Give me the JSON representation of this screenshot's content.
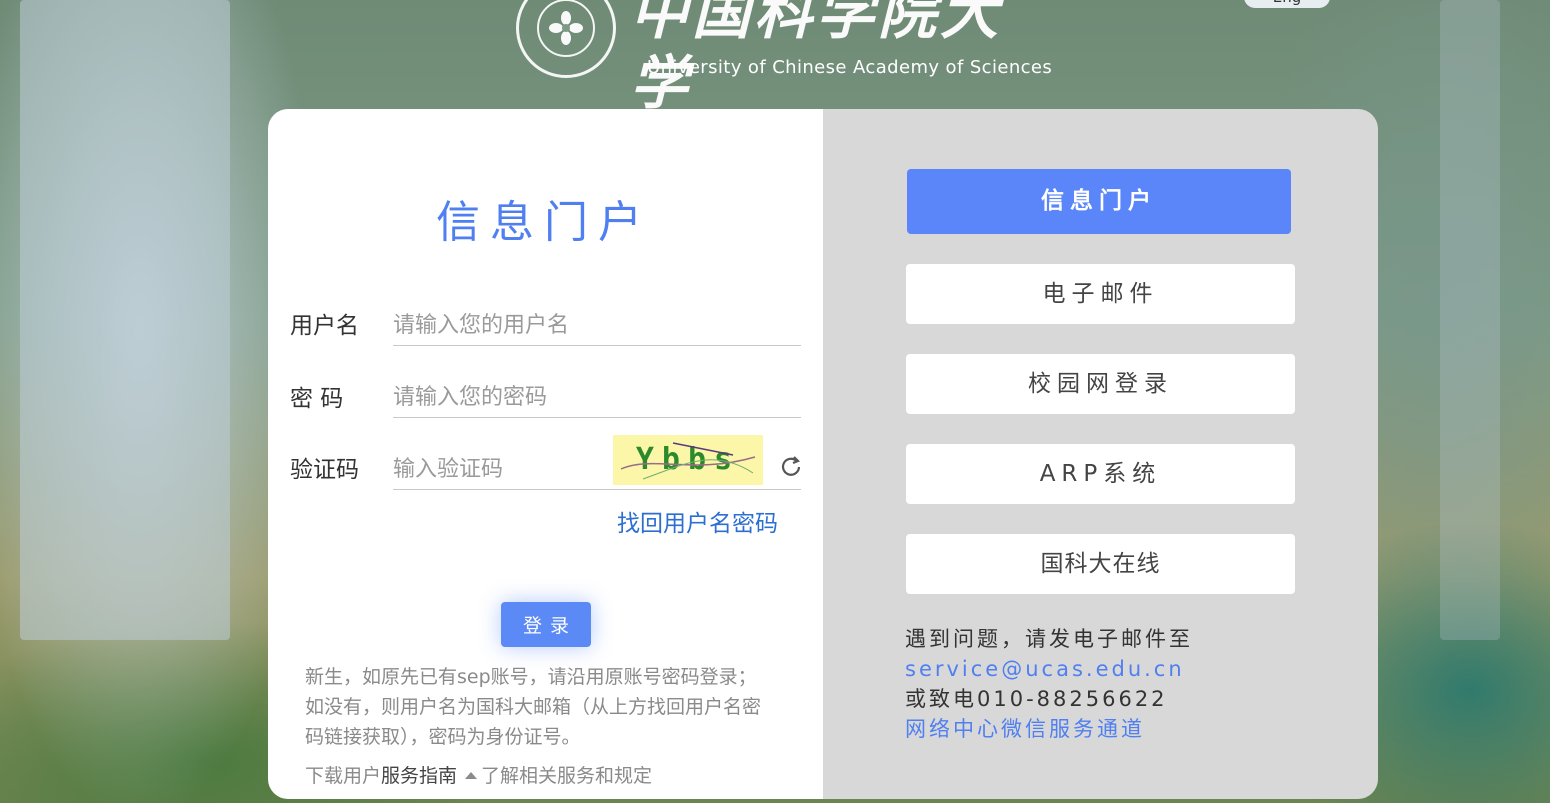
{
  "header": {
    "logo_cn": "中国科学院大学",
    "logo_en": "University of Chinese Academy of Sciences",
    "lang_button": "Eng"
  },
  "login": {
    "title": "信息门户",
    "username_label": "用户名",
    "username_placeholder": "请输入您的用户名",
    "password_label": "密 码",
    "password_placeholder": "请输入您的密码",
    "captcha_label": "验证码",
    "captcha_placeholder": "输入验证码",
    "captcha_text": "Ybbs",
    "forgot_link": "找回用户名密码",
    "login_button": "登录",
    "notice": "新生，如原先已有sep账号，请沿用原账号密码登录；如没有，则用户名为国科大邮箱（从上方找回用户名密码链接获取），密码为身份证号。",
    "guide_prefix": "下载用户",
    "guide_link": "服务指南",
    "guide_suffix": "了解相关服务和规定"
  },
  "nav": {
    "items": [
      {
        "label": "信息门户",
        "active": true
      },
      {
        "label": "电子邮件",
        "active": false
      },
      {
        "label": "校园网登录",
        "active": false
      },
      {
        "label": "ARP系统",
        "active": false
      },
      {
        "label": "国科大在线",
        "active": false
      }
    ]
  },
  "help": {
    "line1": "遇到问题，请发电子邮件至",
    "email": "service@ucas.edu.cn",
    "line3": "或致电010-88256622",
    "wechat_link": "网络中心微信服务通道"
  },
  "colors": {
    "accent": "#5b86fa",
    "title": "#4f7ff0",
    "link": "#2d6fd1",
    "right_panel": "#d8d8d8"
  }
}
